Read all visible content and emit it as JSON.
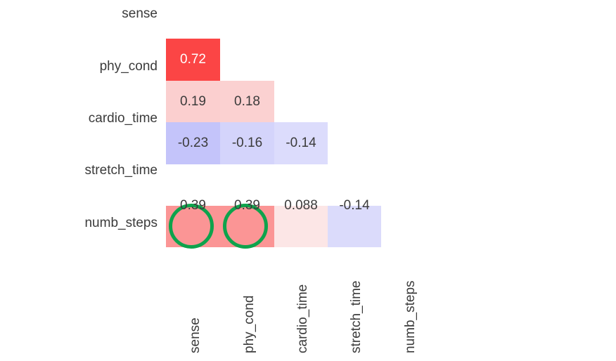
{
  "chart_data": {
    "type": "heatmap",
    "title": "",
    "subtitle": "",
    "xlabel": "",
    "ylabel": "",
    "colormap": "coolwarm (blue-white-red)",
    "value_range": [
      -1,
      1
    ],
    "grid": false,
    "legend": "none",
    "mask": "lower-triangle shown (upper triangle hidden)",
    "row_categories": [
      "sense",
      "phy_cond",
      "cardio_time",
      "stretch_time",
      "numb_steps"
    ],
    "column_categories": [
      "sense",
      "phy_cond",
      "cardio_time",
      "stretch_time",
      "numb_steps"
    ],
    "rows": [
      {
        "label": "sense",
        "cells": []
      },
      {
        "label": "phy_cond",
        "cells": [
          {
            "column": "sense",
            "value": 0.72,
            "text": "0.72",
            "color": "#fb4545",
            "text_color": "#ffffff"
          }
        ]
      },
      {
        "label": "cardio_time",
        "cells": [
          {
            "column": "sense",
            "value": 0.19,
            "text": "0.19",
            "color": "#fbcfcf",
            "text_color": "#3b3b3b"
          },
          {
            "column": "phy_cond",
            "value": 0.18,
            "text": "0.18",
            "color": "#fbd1d1",
            "text_color": "#3b3b3b"
          }
        ]
      },
      {
        "label": "stretch_time",
        "cells": [
          {
            "column": "sense",
            "value": -0.23,
            "text": "-0.23",
            "color": "#c4c4fa",
            "text_color": "#3b3b3b"
          },
          {
            "column": "phy_cond",
            "value": -0.16,
            "text": "-0.16",
            "color": "#d4d4fb",
            "text_color": "#3b3b3b"
          },
          {
            "column": "cardio_time",
            "value": -0.14,
            "text": "-0.14",
            "color": "#dcdcfc",
            "text_color": "#3b3b3b"
          }
        ]
      },
      {
        "label": "numb_steps",
        "cells": [
          {
            "column": "sense",
            "value": 0.39,
            "text": "0.39",
            "color": "#fb9595",
            "text_color": "#3b3b3b"
          },
          {
            "column": "phy_cond",
            "value": 0.39,
            "text": "0.39",
            "color": "#fb9595",
            "text_color": "#3b3b3b"
          },
          {
            "column": "cardio_time",
            "value": 0.088,
            "text": "0.088",
            "color": "#fce6e6",
            "text_color": "#3b3b3b"
          },
          {
            "column": "stretch_time",
            "value": -0.14,
            "text": "-0.14",
            "color": "#dbdbfb",
            "text_color": "#3b3b3b"
          }
        ]
      }
    ],
    "annotations": [
      {
        "shape": "circle",
        "color": "#0ea34c",
        "target_row": "numb_steps",
        "target_column": "sense",
        "target_value": 0.39
      },
      {
        "shape": "circle",
        "color": "#0ea34c",
        "target_row": "numb_steps",
        "target_column": "phy_cond",
        "target_value": 0.39
      }
    ]
  },
  "labels": {
    "row_0": "sense",
    "row_1": "phy_cond",
    "row_2": "cardio_time",
    "row_3": "stretch_time",
    "row_4": "numb_steps",
    "col_0": "sense",
    "col_1": "phy_cond",
    "col_2": "cardio_time",
    "col_3": "stretch_time",
    "col_4": "numb_steps"
  },
  "values": {
    "r1c0": "0.72",
    "r2c0": "0.19",
    "r2c1": "0.18",
    "r3c0": "-0.23",
    "r3c1": "-0.16",
    "r3c2": "-0.14",
    "r4c0": "0.39",
    "r4c1": "0.39",
    "r4c2": "0.088",
    "r4c3": "-0.14"
  },
  "colors": {
    "positive_strong": "#fb4545",
    "positive_mid": "#fb9595",
    "positive_light": "#fbcfcf",
    "positive_faint": "#fce6e6",
    "negative_mid": "#c4c4fa",
    "negative_light": "#d4d4fb",
    "negative_faint": "#dcdcfc",
    "highlight_ring": "#0ea34c",
    "text_dark": "#3b3b3b",
    "text_light": "#ffffff",
    "background": "#ffffff"
  }
}
